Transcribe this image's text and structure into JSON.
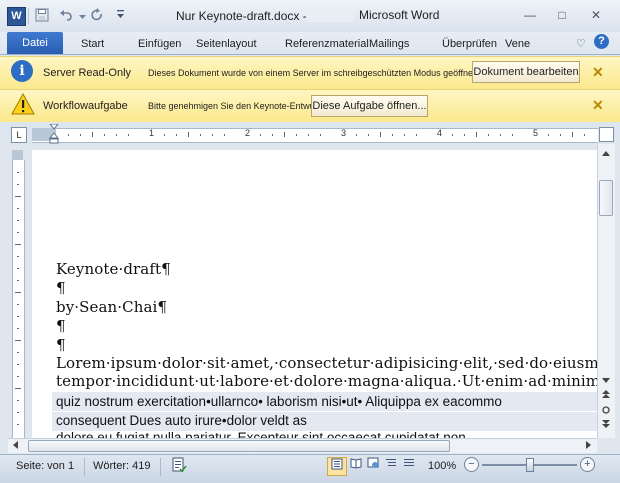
{
  "titlebar": {
    "app_logo": "W",
    "document_title": "Nur Keynote-draft.docx -",
    "app_title": "Microsoft Word",
    "qat_icons": [
      "save-icon",
      "undo-icon",
      "redo-icon",
      "customize-qat-icon"
    ],
    "window_controls": {
      "minimize": "—",
      "maximize": "□",
      "close": "✕"
    }
  },
  "ribbon": {
    "file_tab": "Datei",
    "tabs": [
      "Start",
      "Einfügen",
      "Seitenlayout",
      "Referenzmaterial",
      "Mailings",
      "Überprüfen",
      "Vene"
    ],
    "collapse_icon": "♡",
    "help_icon": "?"
  },
  "messagebars": {
    "server": {
      "title": "Server Read-Only",
      "text": "Dieses Dokument wurde von einem Server im schreibgeschützten Modus geöffnet.",
      "button": "Dokument bearbeiten",
      "close": "✕"
    },
    "workflow": {
      "title": "Workflowaufgabe",
      "text": "Bitte genehmigen Sie den Keynote-Entwurf",
      "button": "Diese Aufgabe öffnen...",
      "close": "✕"
    }
  },
  "ruler": {
    "tab_selector": "L",
    "numbers": [
      "1",
      "2",
      "3",
      "4",
      "5"
    ]
  },
  "document": {
    "lines": [
      "Keynote·draft¶",
      "¶",
      "by·Sean·Chai¶",
      "¶",
      "¶",
      "Lorem·ipsum·dolor·sit·amet,·consectetur·adipisicing·elit,·sed·do·eiusmod",
      "tempor·incididunt·ut·labore·et·dolore·magna·aliqua.·Ut·enim·ad·minim"
    ],
    "suggestion_lines": [
      "quiz nostrum exercitation•ullarnco• laborism nisi•ut• Aliquippa ex eacommo",
      "consequent Dues auto irure•dolor veldt as",
      "dolore eu fugiat nulla pariatur. Excepteur sint occaecat cupidatat non"
    ]
  },
  "statusbar": {
    "page_label": "Seite: von",
    "page_number": "1",
    "words": "Wörter: 419",
    "zoom": "100%"
  },
  "colors": {
    "file_tab": "#2a5eb0",
    "messagebar": "#fbe98c",
    "info_icon": "#2d6ec4",
    "warning_icon": "#e8b400"
  }
}
